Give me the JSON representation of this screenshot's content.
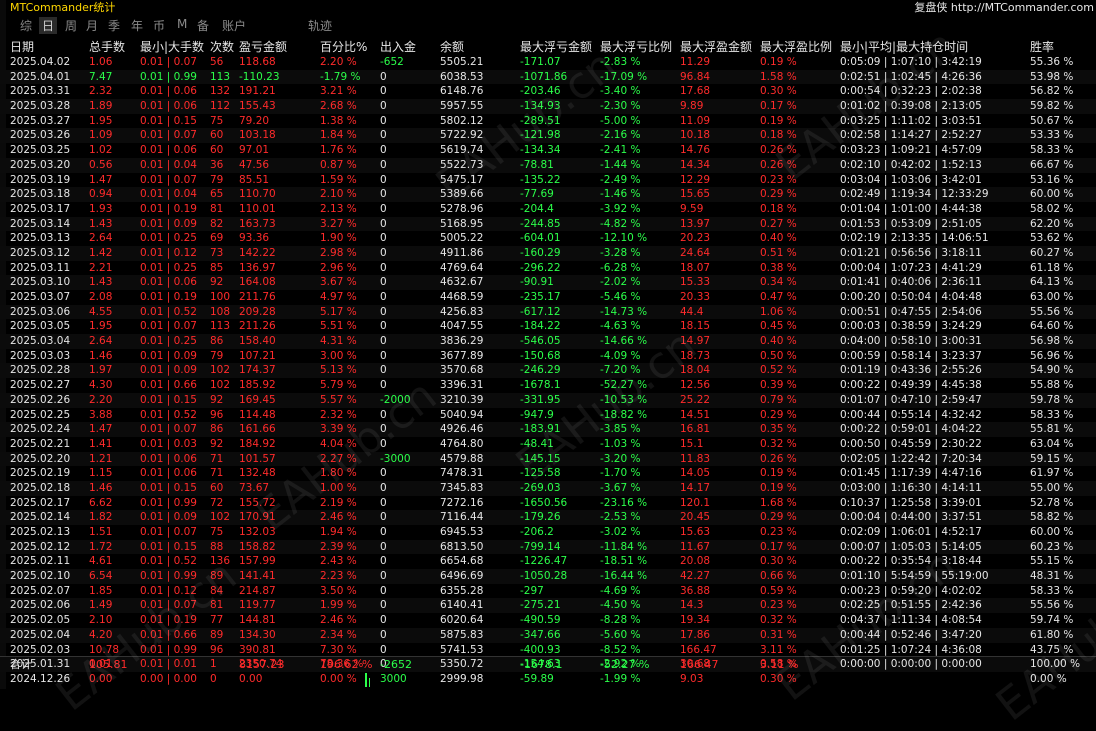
{
  "app_title": "MTCommander统计",
  "brand_text": "复盘侠 http://MTCommander.com",
  "tabs": [
    "综",
    "日",
    "周",
    "月",
    "季",
    "年",
    "币",
    "M",
    "备",
    "账户",
    "轨迹"
  ],
  "active_tab": "日",
  "headers": [
    "日期",
    "总手数",
    "最小|大手数",
    "次数",
    "盈亏金额",
    "百分比%",
    "出入金",
    "余额",
    "最大浮亏金额",
    "最大浮亏比例",
    "最大浮盈金额",
    "最大浮盈比例",
    "最小|平均|最大持仓时间",
    "胜率"
  ],
  "rows": [
    [
      "2025.04.02",
      "1.06",
      "0.01 | 0.07",
      "56",
      "118.68",
      "2.20 %",
      "-652",
      "5505.21",
      "-171.07",
      "-2.83 %",
      "11.29",
      "0.19 %",
      "0:05:09 | 1:07:10 | 3:42:19",
      "55.36 %"
    ],
    [
      "2025.04.01",
      "7.47",
      "0.01 | 0.99",
      "113",
      "-110.23",
      "-1.79 %",
      "0",
      "6038.53",
      "-1071.86",
      "-17.09 %",
      "96.84",
      "1.58 %",
      "0:02:51 | 1:02:45 | 4:26:36",
      "53.98 %"
    ],
    [
      "2025.03.31",
      "2.32",
      "0.01 | 0.06",
      "132",
      "191.21",
      "3.21 %",
      "0",
      "6148.76",
      "-203.46",
      "-3.40 %",
      "17.68",
      "0.30 %",
      "0:00:54 | 0:32:23 | 2:02:38",
      "56.82 %"
    ],
    [
      "2025.03.28",
      "1.89",
      "0.01 | 0.06",
      "112",
      "155.43",
      "2.68 %",
      "0",
      "5957.55",
      "-134.93",
      "-2.30 %",
      "9.89",
      "0.17 %",
      "0:01:02 | 0:39:08 | 2:13:05",
      "59.82 %"
    ],
    [
      "2025.03.27",
      "1.95",
      "0.01 | 0.15",
      "75",
      "79.20",
      "1.38 %",
      "0",
      "5802.12",
      "-289.51",
      "-5.00 %",
      "11.09",
      "0.19 %",
      "0:03:25 | 1:11:02 | 3:03:51",
      "50.67 %"
    ],
    [
      "2025.03.26",
      "1.09",
      "0.01 | 0.07",
      "60",
      "103.18",
      "1.84 %",
      "0",
      "5722.92",
      "-121.98",
      "-2.16 %",
      "10.18",
      "0.18 %",
      "0:02:58 | 1:14:27 | 2:52:27",
      "53.33 %"
    ],
    [
      "2025.03.25",
      "1.02",
      "0.01 | 0.06",
      "60",
      "97.01",
      "1.76 %",
      "0",
      "5619.74",
      "-134.34",
      "-2.41 %",
      "14.76",
      "0.26 %",
      "0:03:23 | 1:09:21 | 4:57:09",
      "58.33 %"
    ],
    [
      "2025.03.20",
      "0.56",
      "0.01 | 0.04",
      "36",
      "47.56",
      "0.87 %",
      "0",
      "5522.73",
      "-78.81",
      "-1.44 %",
      "14.34",
      "0.26 %",
      "0:02:10 | 0:42:02 | 1:52:13",
      "66.67 %"
    ],
    [
      "2025.03.19",
      "1.47",
      "0.01 | 0.07",
      "79",
      "85.51",
      "1.59 %",
      "0",
      "5475.17",
      "-135.22",
      "-2.49 %",
      "12.29",
      "0.23 %",
      "0:03:04 | 1:03:06 | 3:42:01",
      "53.16 %"
    ],
    [
      "2025.03.18",
      "0.94",
      "0.01 | 0.04",
      "65",
      "110.70",
      "2.10 %",
      "0",
      "5389.66",
      "-77.69",
      "-1.46 %",
      "15.65",
      "0.29 %",
      "0:02:49 | 1:19:34 | 12:33:29",
      "60.00 %"
    ],
    [
      "2025.03.17",
      "1.93",
      "0.01 | 0.19",
      "81",
      "110.01",
      "2.13 %",
      "0",
      "5278.96",
      "-204.4",
      "-3.92 %",
      "9.59",
      "0.18 %",
      "0:01:04 | 1:01:00 | 4:44:38",
      "58.02 %"
    ],
    [
      "2025.03.14",
      "1.43",
      "0.01 | 0.09",
      "82",
      "163.73",
      "3.27 %",
      "0",
      "5168.95",
      "-244.85",
      "-4.82 %",
      "13.97",
      "0.27 %",
      "0:01:53 | 0:53:09 | 2:51:05",
      "62.20 %"
    ],
    [
      "2025.03.13",
      "2.64",
      "0.01 | 0.25",
      "69",
      "93.36",
      "1.90 %",
      "0",
      "5005.22",
      "-604.01",
      "-12.10 %",
      "20.23",
      "0.40 %",
      "0:02:19 | 2:13:35 | 14:06:51",
      "53.62 %"
    ],
    [
      "2025.03.12",
      "1.42",
      "0.01 | 0.12",
      "73",
      "142.22",
      "2.98 %",
      "0",
      "4911.86",
      "-160.29",
      "-3.28 %",
      "24.64",
      "0.51 %",
      "0:01:21 | 0:56:56 | 3:18:11",
      "60.27 %"
    ],
    [
      "2025.03.11",
      "2.21",
      "0.01 | 0.25",
      "85",
      "136.97",
      "2.96 %",
      "0",
      "4769.64",
      "-296.22",
      "-6.28 %",
      "18.07",
      "0.38 %",
      "0:00:04 | 1:07:23 | 4:41:29",
      "61.18 %"
    ],
    [
      "2025.03.10",
      "1.43",
      "0.01 | 0.06",
      "92",
      "164.08",
      "3.67 %",
      "0",
      "4632.67",
      "-90.91",
      "-2.02 %",
      "15.33",
      "0.34 %",
      "0:01:41 | 0:40:06 | 2:36:11",
      "64.13 %"
    ],
    [
      "2025.03.07",
      "2.08",
      "0.01 | 0.19",
      "100",
      "211.76",
      "4.97 %",
      "0",
      "4468.59",
      "-235.17",
      "-5.46 %",
      "20.33",
      "0.47 %",
      "0:00:20 | 0:50:04 | 4:04:48",
      "63.00 %"
    ],
    [
      "2025.03.06",
      "4.55",
      "0.01 | 0.52",
      "108",
      "209.28",
      "5.17 %",
      "0",
      "4256.83",
      "-617.12",
      "-14.73 %",
      "44.4",
      "1.06 %",
      "0:00:51 | 0:47:55 | 2:54:06",
      "55.56 %"
    ],
    [
      "2025.03.05",
      "1.95",
      "0.01 | 0.07",
      "113",
      "211.26",
      "5.51 %",
      "0",
      "4047.55",
      "-184.22",
      "-4.63 %",
      "18.15",
      "0.45 %",
      "0:00:03 | 0:38:59 | 3:24:29",
      "64.60 %"
    ],
    [
      "2025.03.04",
      "2.64",
      "0.01 | 0.25",
      "86",
      "158.40",
      "4.31 %",
      "0",
      "3836.29",
      "-546.05",
      "-14.66 %",
      "14.97",
      "0.40 %",
      "0:04:00 | 0:58:10 | 3:00:31",
      "56.98 %"
    ],
    [
      "2025.03.03",
      "1.46",
      "0.01 | 0.09",
      "79",
      "107.21",
      "3.00 %",
      "0",
      "3677.89",
      "-150.68",
      "-4.09 %",
      "18.73",
      "0.50 %",
      "0:00:59 | 0:58:14 | 3:23:37",
      "56.96 %"
    ],
    [
      "2025.02.28",
      "1.97",
      "0.01 | 0.09",
      "102",
      "174.37",
      "5.13 %",
      "0",
      "3570.68",
      "-246.29",
      "-7.20 %",
      "18.04",
      "0.52 %",
      "0:01:19 | 0:43:36 | 2:55:26",
      "54.90 %"
    ],
    [
      "2025.02.27",
      "4.30",
      "0.01 | 0.66",
      "102",
      "185.92",
      "5.79 %",
      "0",
      "3396.31",
      "-1678.1",
      "-52.27 %",
      "12.56",
      "0.39 %",
      "0:00:22 | 0:49:39 | 4:45:38",
      "55.88 %"
    ],
    [
      "2025.02.26",
      "2.20",
      "0.01 | 0.15",
      "92",
      "169.45",
      "5.57 %",
      "-2000",
      "3210.39",
      "-331.95",
      "-10.53 %",
      "25.22",
      "0.79 %",
      "0:01:07 | 0:47:10 | 2:59:47",
      "59.78 %"
    ],
    [
      "2025.02.25",
      "3.88",
      "0.01 | 0.52",
      "96",
      "114.48",
      "2.32 %",
      "0",
      "5040.94",
      "-947.9",
      "-18.82 %",
      "14.51",
      "0.29 %",
      "0:00:44 | 0:55:14 | 4:32:42",
      "58.33 %"
    ],
    [
      "2025.02.24",
      "1.47",
      "0.01 | 0.07",
      "86",
      "161.66",
      "3.39 %",
      "0",
      "4926.46",
      "-183.91",
      "-3.85 %",
      "16.81",
      "0.35 %",
      "0:00:22 | 0:59:01 | 4:04:22",
      "55.81 %"
    ],
    [
      "2025.02.21",
      "1.41",
      "0.01 | 0.03",
      "92",
      "184.92",
      "4.04 %",
      "0",
      "4764.80",
      "-48.41",
      "-1.03 %",
      "15.1",
      "0.32 %",
      "0:00:50 | 0:45:59 | 2:30:22",
      "63.04 %"
    ],
    [
      "2025.02.20",
      "1.21",
      "0.01 | 0.06",
      "71",
      "101.57",
      "2.27 %",
      "-3000",
      "4579.88",
      "-145.15",
      "-3.20 %",
      "11.83",
      "0.26 %",
      "0:02:05 | 1:22:42 | 7:20:34",
      "59.15 %"
    ],
    [
      "2025.02.19",
      "1.15",
      "0.01 | 0.06",
      "71",
      "132.48",
      "1.80 %",
      "0",
      "7478.31",
      "-125.58",
      "-1.70 %",
      "14.05",
      "0.19 %",
      "0:01:45 | 1:17:39 | 4:47:16",
      "61.97 %"
    ],
    [
      "2025.02.18",
      "1.46",
      "0.01 | 0.15",
      "60",
      "73.67",
      "1.00 %",
      "0",
      "7345.83",
      "-269.03",
      "-3.67 %",
      "14.17",
      "0.19 %",
      "0:03:00 | 1:16:30 | 4:14:11",
      "55.00 %"
    ],
    [
      "2025.02.17",
      "6.62",
      "0.01 | 0.99",
      "72",
      "155.72",
      "2.19 %",
      "0",
      "7272.16",
      "-1650.56",
      "-23.16 %",
      "120.1",
      "1.68 %",
      "0:10:37 | 1:25:58 | 3:39:01",
      "52.78 %"
    ],
    [
      "2025.02.14",
      "1.82",
      "0.01 | 0.09",
      "102",
      "170.91",
      "2.46 %",
      "0",
      "7116.44",
      "-179.26",
      "-2.53 %",
      "20.45",
      "0.29 %",
      "0:00:04 | 0:44:00 | 3:37:51",
      "58.82 %"
    ],
    [
      "2025.02.13",
      "1.51",
      "0.01 | 0.07",
      "75",
      "132.03",
      "1.94 %",
      "0",
      "6945.53",
      "-206.2",
      "-3.02 %",
      "15.63",
      "0.23 %",
      "0:02:09 | 1:06:01 | 4:52:17",
      "60.00 %"
    ],
    [
      "2025.02.12",
      "1.72",
      "0.01 | 0.15",
      "88",
      "158.82",
      "2.39 %",
      "0",
      "6813.50",
      "-799.14",
      "-11.84 %",
      "11.67",
      "0.17 %",
      "0:00:07 | 1:05:03 | 5:14:05",
      "60.23 %"
    ],
    [
      "2025.02.11",
      "4.61",
      "0.01 | 0.52",
      "136",
      "157.99",
      "2.43 %",
      "0",
      "6654.68",
      "-1226.47",
      "-18.51 %",
      "20.08",
      "0.30 %",
      "0:00:22 | 0:35:54 | 3:18:44",
      "55.15 %"
    ],
    [
      "2025.02.10",
      "6.54",
      "0.01 | 0.99",
      "89",
      "141.41",
      "2.23 %",
      "0",
      "6496.69",
      "-1050.28",
      "-16.44 %",
      "42.27",
      "0.66 %",
      "0:01:10 | 5:54:59 | 55:19:00",
      "48.31 %"
    ],
    [
      "2025.02.07",
      "1.85",
      "0.01 | 0.12",
      "84",
      "214.87",
      "3.50 %",
      "0",
      "6355.28",
      "-297",
      "-4.69 %",
      "36.88",
      "0.59 %",
      "0:00:23 | 0:59:20 | 4:02:02",
      "58.33 %"
    ],
    [
      "2025.02.06",
      "1.49",
      "0.01 | 0.07",
      "81",
      "119.77",
      "1.99 %",
      "0",
      "6140.41",
      "-275.21",
      "-4.50 %",
      "14.3",
      "0.23 %",
      "0:02:25 | 0:51:55 | 2:42:36",
      "55.56 %"
    ],
    [
      "2025.02.05",
      "2.10",
      "0.01 | 0.19",
      "77",
      "144.81",
      "2.46 %",
      "0",
      "6020.64",
      "-490.59",
      "-8.28 %",
      "19.34",
      "0.32 %",
      "0:04:37 | 1:11:34 | 4:08:54",
      "59.74 %"
    ],
    [
      "2025.02.04",
      "4.20",
      "0.01 | 0.66",
      "89",
      "134.30",
      "2.34 %",
      "0",
      "5875.83",
      "-347.66",
      "-5.60 %",
      "17.86",
      "0.31 %",
      "0:00:44 | 0:52:46 | 3:47:20",
      "61.80 %"
    ],
    [
      "2025.02.03",
      "10.78",
      "0.01 | 0.99",
      "96",
      "390.81",
      "7.30 %",
      "0",
      "5741.53",
      "-400.93",
      "-8.52 %",
      "166.47",
      "3.11 %",
      "0:01:25 | 1:07:24 | 4:36:08",
      "43.75 %"
    ],
    [
      "2025.01.31",
      "0.01",
      "0.01 | 0.01",
      "1",
      "2350.74",
      "78.36 %",
      "0",
      "5350.72",
      "-154.63",
      "-2.92 %",
      "30.68",
      "0.58 %",
      "0:00:00 | 0:00:00 | 0:00:00",
      "100.00 %"
    ],
    [
      "2024.12.26",
      "0.00",
      "0.00 | 0.00",
      "0",
      "0.00",
      "0.00 %",
      "3000",
      "2999.98",
      "-59.89",
      "-1.99 %",
      "9.03",
      "0.30 %",
      "",
      "0.00 %"
    ]
  ],
  "totals": [
    "合计",
    "105.81",
    "",
    "",
    "8157.23",
    "196.62 %",
    "-2652",
    "",
    "-1678.1",
    "-52.27 %",
    "166.47",
    "3.11 %",
    "",
    ""
  ],
  "watermark": "EAHub.cn",
  "colors": {
    "red": "#ff2b2b",
    "green": "#2bff4a",
    "title": "#ffd700"
  }
}
